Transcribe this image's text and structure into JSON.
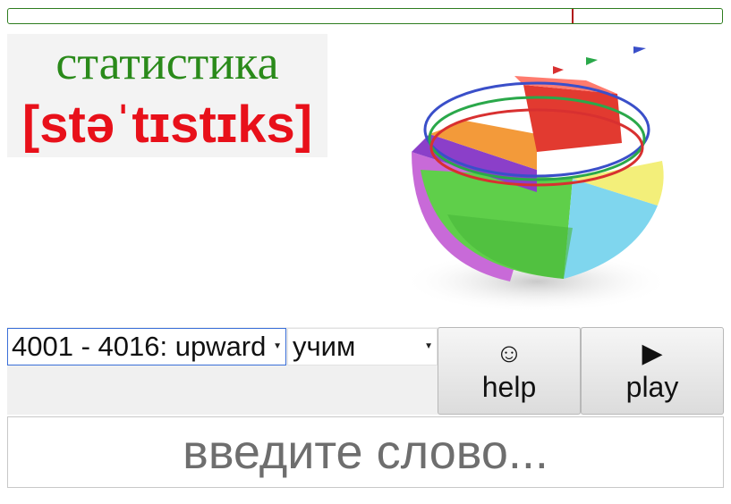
{
  "progress": {
    "position_fraction": 0.79,
    "bar_color": "#2e7d1f",
    "marker_color": "#b0151b"
  },
  "card": {
    "word": "статистика",
    "transcription": "[stəˈtɪstɪks]",
    "word_color": "#2a8a1a",
    "transcription_color": "#e8101a",
    "illustration_icon": "pie-chart-hemisphere-icon"
  },
  "controls": {
    "range_select_value": "4001 - 4016: upward",
    "mode_select_value": "учим",
    "help_icon": "☺",
    "help_label": "help",
    "play_icon": "▶",
    "play_label": "play"
  },
  "answer": {
    "placeholder": "введите слово..."
  }
}
